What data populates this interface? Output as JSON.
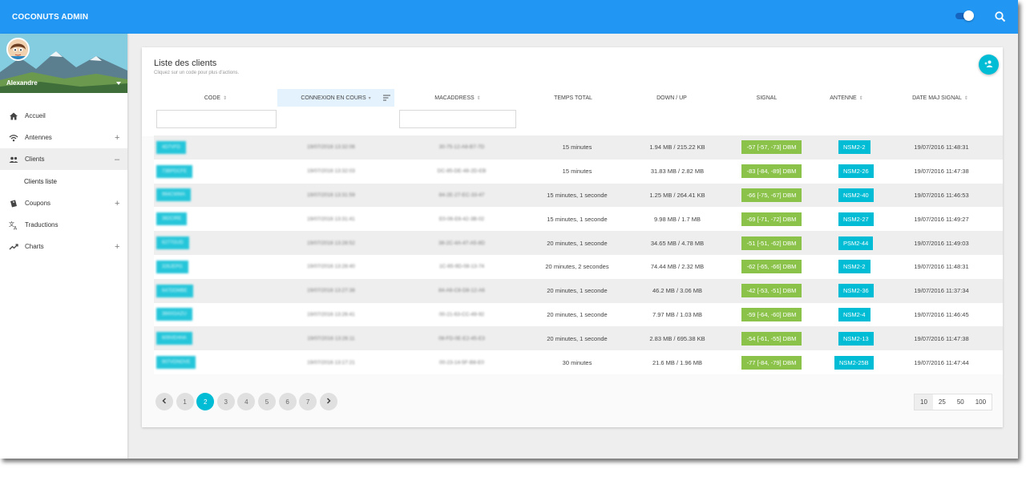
{
  "app": {
    "title": "COCONUTS ADMIN"
  },
  "topbar": {
    "toggle_icon": "toggle-switch-icon",
    "search_icon": "search-icon"
  },
  "user": {
    "name": "Alexandre"
  },
  "sidebar": {
    "items": [
      {
        "label": "Accueil",
        "icon": "home-icon",
        "toggle": ""
      },
      {
        "label": "Antennes",
        "icon": "wifi-icon",
        "toggle": "+"
      },
      {
        "label": "Clients",
        "icon": "people-icon",
        "toggle": "–"
      },
      {
        "label": "Coupons",
        "icon": "ticket-icon",
        "toggle": "+"
      },
      {
        "label": "Traductions",
        "icon": "translate-icon",
        "toggle": ""
      },
      {
        "label": "Charts",
        "icon": "trending-up-icon",
        "toggle": "+"
      }
    ],
    "sub_item": "Clients liste"
  },
  "card": {
    "title": "Liste des clients",
    "subtitle": "Cliquez sur un code pour plus d'actions."
  },
  "table": {
    "headers": [
      "CODE",
      "CONNEXION EN COURS",
      "MACADDRESS",
      "TEMPS TOTAL",
      "DOWN / UP",
      "SIGNAL",
      "ANTENNE",
      "DATE MAJ SIGNAL"
    ],
    "rows": [
      {
        "code": "4D7VFD",
        "connexion": "19/07/2016 13:32:06",
        "mac": "30-75-12-A8-B7-7D",
        "temps": "15 minutes",
        "downup": "1.94 MB / 215.22 KB",
        "signal": "-57 [-57, -73] DBM",
        "antenne": "NSM2-2",
        "date": "19/07/2016 11:48:31"
      },
      {
        "code": "73BPDCFE",
        "connexion": "19/07/2016 13:32:03",
        "mac": "DC-85-DE-48-2D-EB",
        "temps": "15 minutes",
        "downup": "31.83 MB / 2.82 MB",
        "signal": "-83 [-84, -89] DBM",
        "antenne": "NSM2-26",
        "date": "19/07/2016 11:47:38"
      },
      {
        "code": "964CWMA",
        "connexion": "19/07/2016 13:31:59",
        "mac": "84-2E-27-EC-33-47",
        "temps": "15 minutes, 1 seconde",
        "downup": "1.25 MB / 264.41 KB",
        "signal": "-66 [-75, -67] DBM",
        "antenne": "NSM2-40",
        "date": "19/07/2016 11:46:53"
      },
      {
        "code": "382CIRE",
        "connexion": "19/07/2016 13:31:41",
        "mac": "E0-06-E6-42-3B-02",
        "temps": "15 minutes, 1 seconde",
        "downup": "9.98 MB / 1.7 MB",
        "signal": "-69 [-71, -72] DBM",
        "antenne": "NSM2-27",
        "date": "19/07/2016 11:49:27"
      },
      {
        "code": "6277GUD",
        "connexion": "19/07/2016 13:28:52",
        "mac": "38-2C-4A-47-A5-8D",
        "temps": "20 minutes, 1 seconde",
        "downup": "34.65 MB / 4.78 MB",
        "signal": "-51 [-51, -62] DBM",
        "antenne": "PSM2-44",
        "date": "19/07/2016 11:49:03"
      },
      {
        "code": "326JEPG",
        "connexion": "19/07/2016 13:28:40",
        "mac": "1C-65-9D-08-13-74",
        "temps": "20 minutes, 2 secondes",
        "downup": "74.44 MB / 2.32 MB",
        "signal": "-62 [-65, -66] DBM",
        "antenne": "NSM2-2",
        "date": "19/07/2016 11:48:31"
      },
      {
        "code": "647DDMBE",
        "connexion": "19/07/2016 13:27:38",
        "mac": "84-A6-C8-D8-12-A6",
        "temps": "20 minutes, 1 seconde",
        "downup": "46.2 MB / 3.06 MB",
        "signal": "-42 [-53, -51] DBM",
        "antenne": "NSM2-36",
        "date": "19/07/2016 11:37:34"
      },
      {
        "code": "384XGAZU",
        "connexion": "19/07/2016 13:26:41",
        "mac": "00-21-63-CC-49-92",
        "temps": "20 minutes, 1 seconde",
        "downup": "7.97 MB / 1.03 MB",
        "signal": "-59 [-64, -60] DBM",
        "antenne": "NSM2-4",
        "date": "19/07/2016 11:46:45"
      },
      {
        "code": "609VEHHA",
        "connexion": "19/07/2016 13:26:11",
        "mac": "08-FD-0E-E2-45-E3",
        "temps": "20 minutes, 1 seconde",
        "downup": "2.83 MB / 695.38 KB",
        "signal": "-54 [-61, -55] DBM",
        "antenne": "NSM2-13",
        "date": "19/07/2016 11:47:38"
      },
      {
        "code": "907VDNOVE",
        "connexion": "19/07/2016 13:17:21",
        "mac": "00-23-14-5F-B8-E0",
        "temps": "30 minutes",
        "downup": "21.6 MB / 1.96 MB",
        "signal": "-77 [-84, -79] DBM",
        "antenne": "NSM2-25B",
        "date": "19/07/2016 11:47:44"
      }
    ]
  },
  "pagination": {
    "prev": "‹",
    "pages": [
      "1",
      "2",
      "3",
      "4",
      "5",
      "6",
      "7"
    ],
    "current": "2",
    "next": "›"
  },
  "page_size": {
    "options": [
      "10",
      "25",
      "50",
      "100"
    ],
    "selected": "10"
  },
  "colors": {
    "primary": "#2196f3",
    "accent": "#00bcd4",
    "signal": "#8bc34a"
  }
}
